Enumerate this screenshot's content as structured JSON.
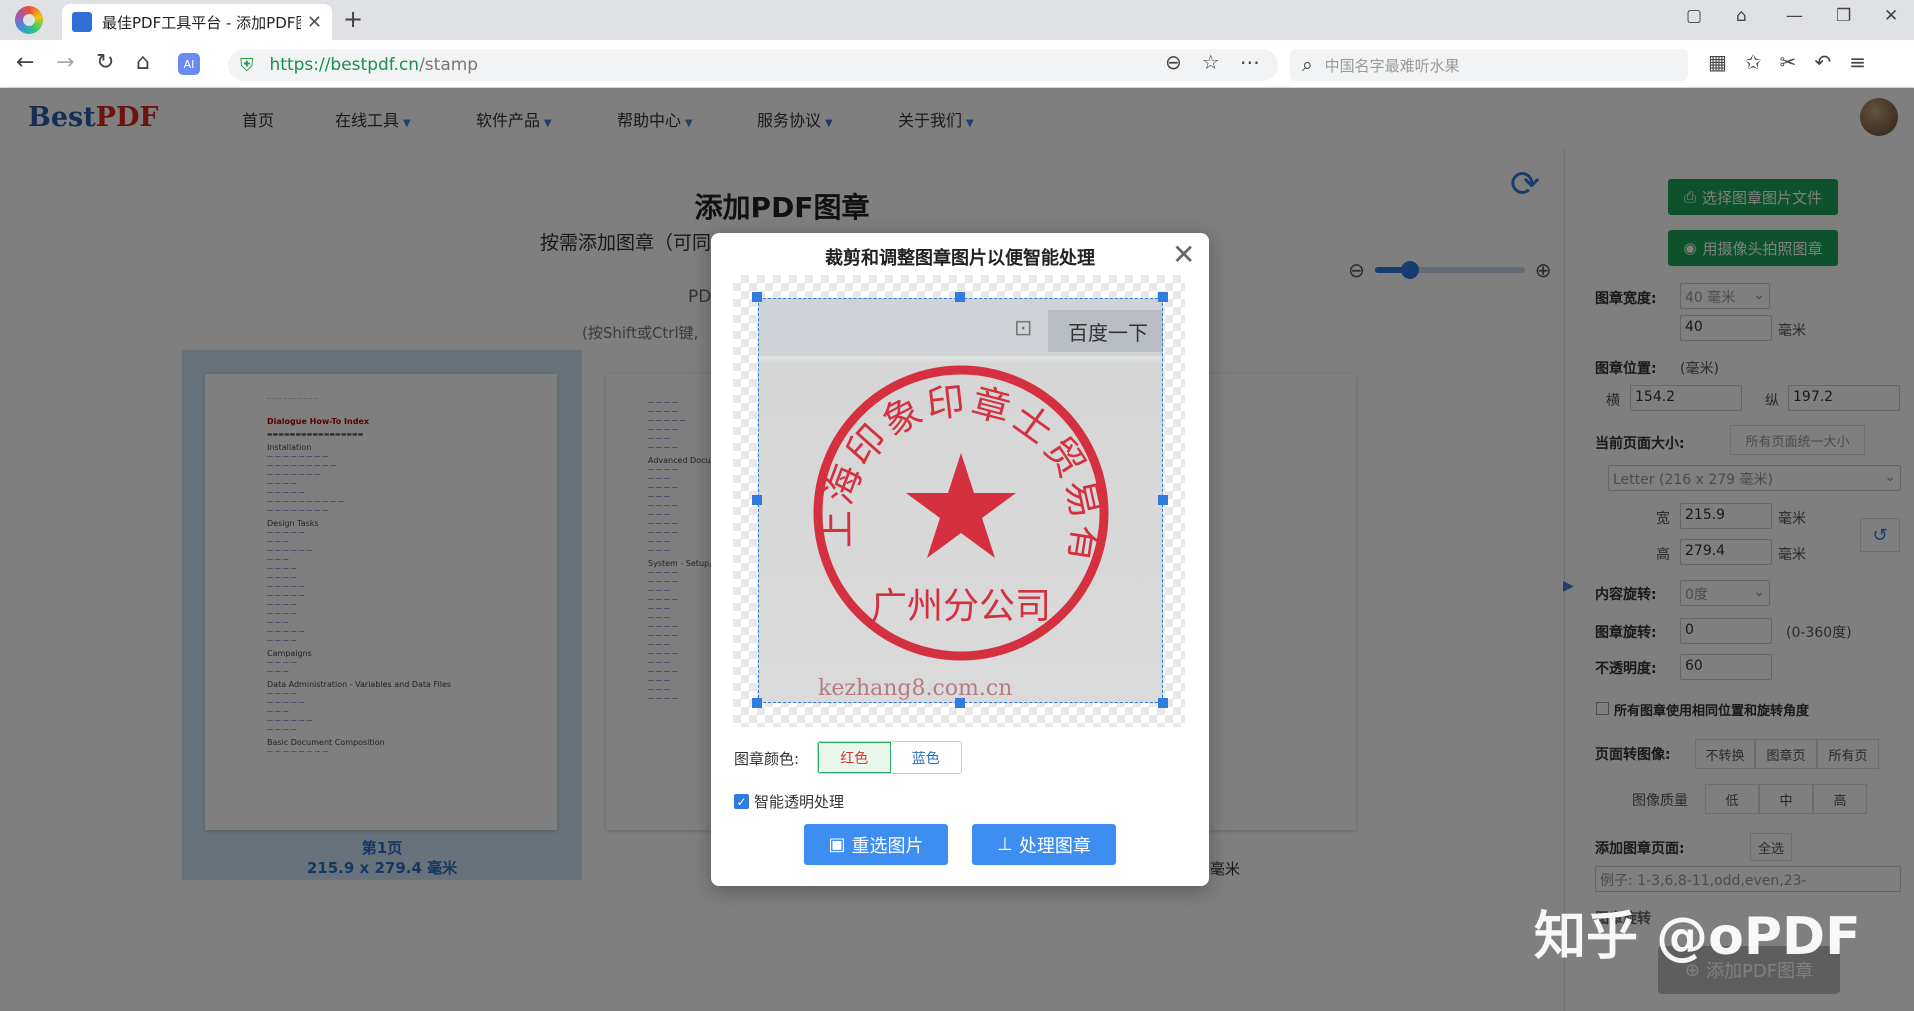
{
  "browser": {
    "tab_title": "最佳PDF工具平台 - 添加PDF图",
    "url_scheme_host": "https://bestpdf.cn",
    "url_path": "/stamp",
    "search_placeholder": "中国名字最难听水果"
  },
  "site": {
    "brand_best": "Best",
    "brand_pdf": "PDF",
    "nav": [
      "首页",
      "在线工具",
      "软件产品",
      "帮助中心",
      "服务协议",
      "关于我们"
    ]
  },
  "main": {
    "title": "添加PDF图章",
    "subtitle": "按需添加图章（可同",
    "pdf_label": "PD",
    "hint": "(按Shift或Ctrl键,",
    "page_label": "第1页",
    "page_size": "215.9 x 279.4 毫米",
    "unit_mm": "毫米",
    "doc_heading": "Dialogue How-To Index",
    "doc_sections": [
      "Installation",
      "Design Tasks",
      "Campaigns",
      "Data Administration - Variables and Data Files",
      "Basic Document Composition"
    ],
    "doc2_sections": [
      "Advanced Docum",
      "System - Setup, A"
    ],
    "zoom_level": 0.2
  },
  "panel": {
    "select_image_btn": "选择图章图片文件",
    "camera_btn": "用摄像头拍照图章",
    "width_label": "图章宽度:",
    "width_select": "40 毫米",
    "width_value": "40",
    "unit": "毫米",
    "position_label": "图章位置:",
    "position_unit": "(毫米)",
    "x_label": "横",
    "x_value": "154.2",
    "y_label": "纵",
    "y_value": "197.2",
    "page_size_label": "当前页面大小:",
    "unify_btn": "所有页面统一大小",
    "paper_select": "Letter (216 x 279 毫米)",
    "w_label": "宽",
    "w_value": "215.9",
    "h_label": "高",
    "h_value": "279.4",
    "content_rot_label": "内容旋转:",
    "content_rot_value": "0度",
    "stamp_rot_label": "图章旋转:",
    "stamp_rot_value": "0",
    "stamp_rot_range": "(0-360度)",
    "opacity_label": "不透明度:",
    "opacity_value": "60",
    "same_pos_label": "所有图章使用相同位置和旋转角度",
    "page_to_image_label": "页面转图像:",
    "convert_opts": [
      "不转换",
      "图章页",
      "所有页"
    ],
    "quality_label": "图像质量",
    "quality_opts": [
      "低",
      "中",
      "高"
    ],
    "add_pages_label": "添加图章页面:",
    "select_all_btn": "全选",
    "pages_placeholder": "例子: 1-3,6,8-11,odd,even,23-",
    "hidden_label": "图章旋转",
    "add_stamp_btn": "添加PDF图章"
  },
  "modal": {
    "title": "裁剪和调整图章图片以便智能处理",
    "color_label": "图章颜色:",
    "color_red": "红色",
    "color_blue": "蓝色",
    "smart_transparent": "智能透明处理",
    "reselect_btn": "重选图片",
    "process_btn": "处理图章",
    "photo_search_btn": "百度一下",
    "seal_text": "上海印象印章士贸易有限公司",
    "seal_sub": "广州分公司",
    "photo_watermark": "kezhang8.com.cn",
    "seal_color": "#d4303f"
  },
  "watermark": "知乎 @oPDF",
  "colors": {
    "accent_blue": "#3d8ef0",
    "green": "#1aa55a",
    "red": "#d8392b"
  }
}
